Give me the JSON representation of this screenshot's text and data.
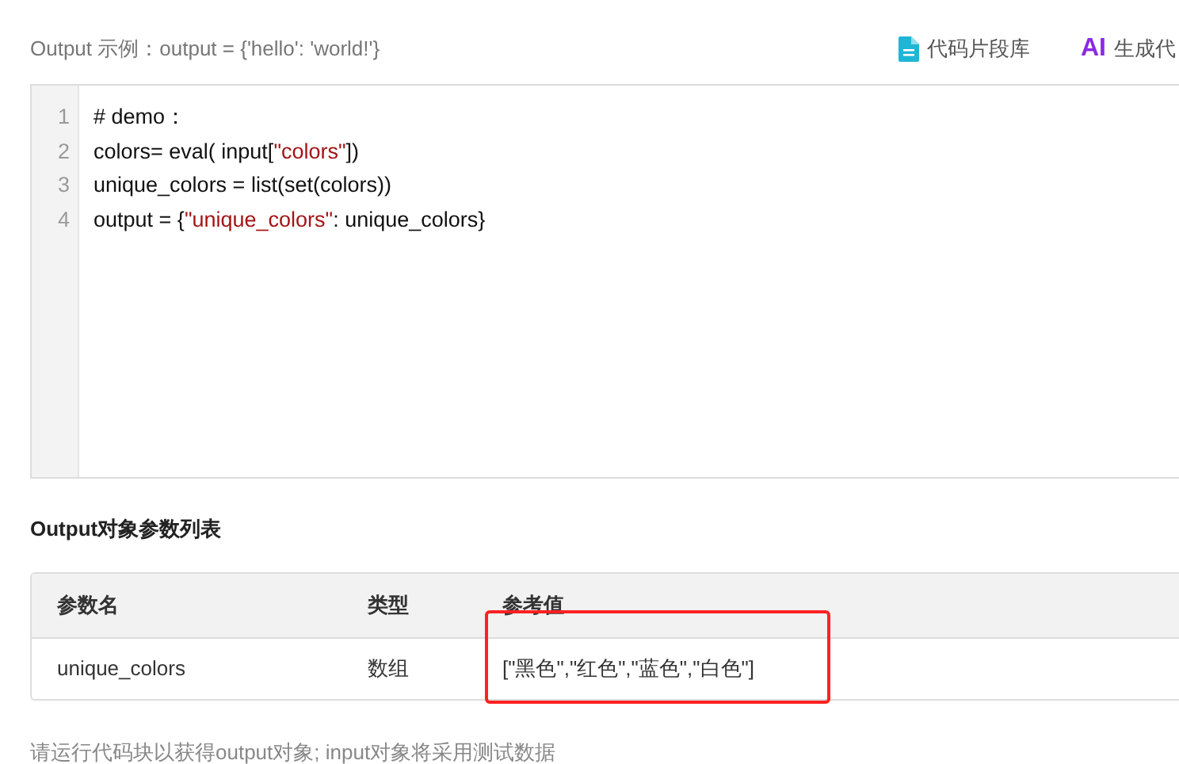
{
  "example": "Output 示例：output = {'hello': 'world!'}",
  "actions": [
    {
      "kind": "snippet",
      "label": "代码片段库"
    },
    {
      "kind": "ai",
      "prefix": "AI",
      "label": "生成代"
    }
  ],
  "code_lines": [
    {
      "number": "1",
      "tokens": [
        {
          "kind": "plain",
          "text": "# demo："
        }
      ]
    },
    {
      "number": "2",
      "tokens": [
        {
          "kind": "plain",
          "text": "colors= eval( input["
        },
        {
          "kind": "string",
          "text": "\"colors\""
        },
        {
          "kind": "plain",
          "text": "])"
        }
      ]
    },
    {
      "number": "3",
      "tokens": [
        {
          "kind": "plain",
          "text": "unique_colors = list(set(colors))"
        }
      ]
    },
    {
      "number": "4",
      "tokens": [
        {
          "kind": "plain",
          "text": "output = {"
        },
        {
          "kind": "string",
          "text": "\"unique_colors\""
        },
        {
          "kind": "plain",
          "text": ": unique_colors}"
        }
      ]
    }
  ],
  "output_table": {
    "title": "Output对象参数列表",
    "columns": [
      "参数名",
      "类型",
      "参考值"
    ],
    "rows": [
      {
        "cells": [
          "unique_colors",
          "数组",
          "[\"黑色\",\"红色\",\"蓝色\",\"白色\"]"
        ],
        "highlighted": true
      }
    ]
  },
  "hint": "请运行代码块以获得output对象; input对象将采用测试数据"
}
